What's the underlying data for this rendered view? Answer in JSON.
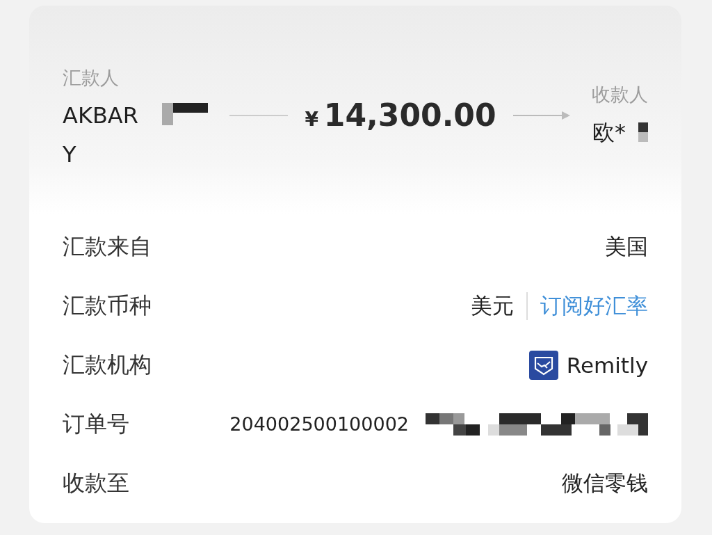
{
  "transfer": {
    "sender": {
      "label": "汇款人",
      "name": "AKBAR Y"
    },
    "amount": {
      "currency": "¥",
      "value": "14,300.00"
    },
    "receiver": {
      "label": "收款人",
      "name": "欧*"
    }
  },
  "details": [
    {
      "kind": "text",
      "label": "汇款来自",
      "value": "美国"
    },
    {
      "kind": "currency",
      "label": "汇款币种",
      "value": "美元",
      "link": "订阅好汇率"
    },
    {
      "kind": "institution",
      "label": "汇款机构",
      "value": "Remitly"
    },
    {
      "kind": "order",
      "label": "订单号",
      "value": "204002500100002"
    },
    {
      "kind": "text",
      "label": "收款至",
      "value": "微信零钱"
    }
  ]
}
